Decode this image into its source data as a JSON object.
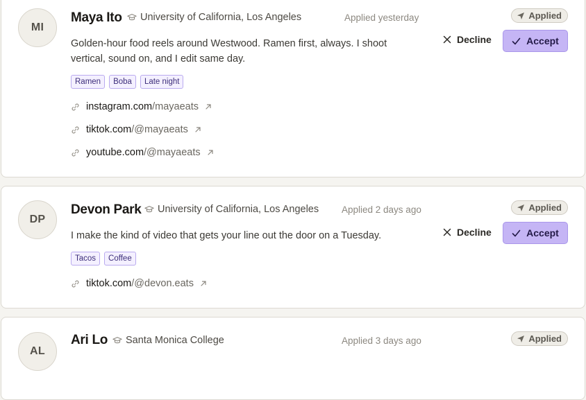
{
  "applications": [
    {
      "initials": "MI",
      "name": "Maya Ito",
      "school": "University of California, Los Angeles",
      "applied_at": "Applied yesterday",
      "status": "Applied",
      "decline_label": "Decline",
      "accept_label": "Accept",
      "bio": "Golden-hour food reels around Westwood. Ramen first, always. I shoot vertical, sound on, and I edit same day.",
      "tags": [
        "Ramen",
        "Boba",
        "Late night"
      ],
      "links": [
        {
          "domain": "instagram.com",
          "handle": "/mayaeats"
        },
        {
          "domain": "tiktok.com",
          "handle": "/@mayaeats"
        },
        {
          "domain": "youtube.com",
          "handle": "/@mayaeats"
        }
      ]
    },
    {
      "initials": "DP",
      "name": "Devon Park",
      "school": "University of California, Los Angeles",
      "applied_at": "Applied 2 days ago",
      "status": "Applied",
      "decline_label": "Decline",
      "accept_label": "Accept",
      "bio": "I make the kind of video that gets your line out the door on a Tuesday.",
      "tags": [
        "Tacos",
        "Coffee"
      ],
      "links": [
        {
          "domain": "tiktok.com",
          "handle": "/@devon.eats"
        }
      ]
    },
    {
      "initials": "AL",
      "name": "Ari Lo",
      "school": "Santa Monica College",
      "applied_at": "Applied 3 days ago",
      "status": "Applied"
    }
  ],
  "colors": {
    "accent": "#c5b5f5",
    "accent_border": "#a996ea",
    "tag_border": "#b9aaef",
    "page_background": "#f5f4f0"
  },
  "icons": {
    "school": "graduation-cap-icon",
    "status": "send-icon",
    "decline": "close-icon",
    "accept": "check-icon",
    "link": "link-icon",
    "external": "external-link-icon"
  }
}
